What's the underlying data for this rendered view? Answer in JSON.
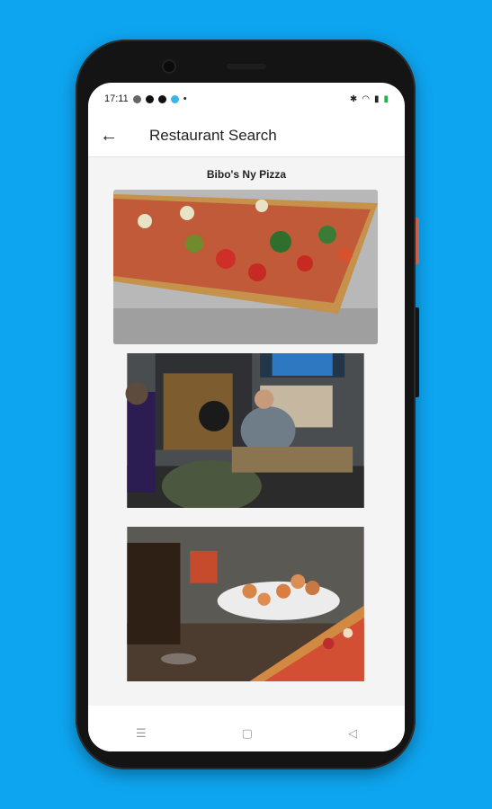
{
  "status_bar": {
    "time": "17:11",
    "dot": "•"
  },
  "app_bar": {
    "back_icon": "arrow-left-icon",
    "title": "Restaurant Search"
  },
  "restaurant": {
    "name": "Bibo's Ny Pizza"
  },
  "photos": [
    {
      "alt": "pizza-slice-photo"
    },
    {
      "alt": "restaurant-interior-photo"
    },
    {
      "alt": "wings-and-pizza-photo"
    }
  ],
  "nav_bar": {
    "recent": "☰",
    "home": "▢",
    "back": "◁"
  },
  "colors": {
    "background": "#0ea5f0",
    "phone": "#141414",
    "screen": "#ffffff"
  }
}
